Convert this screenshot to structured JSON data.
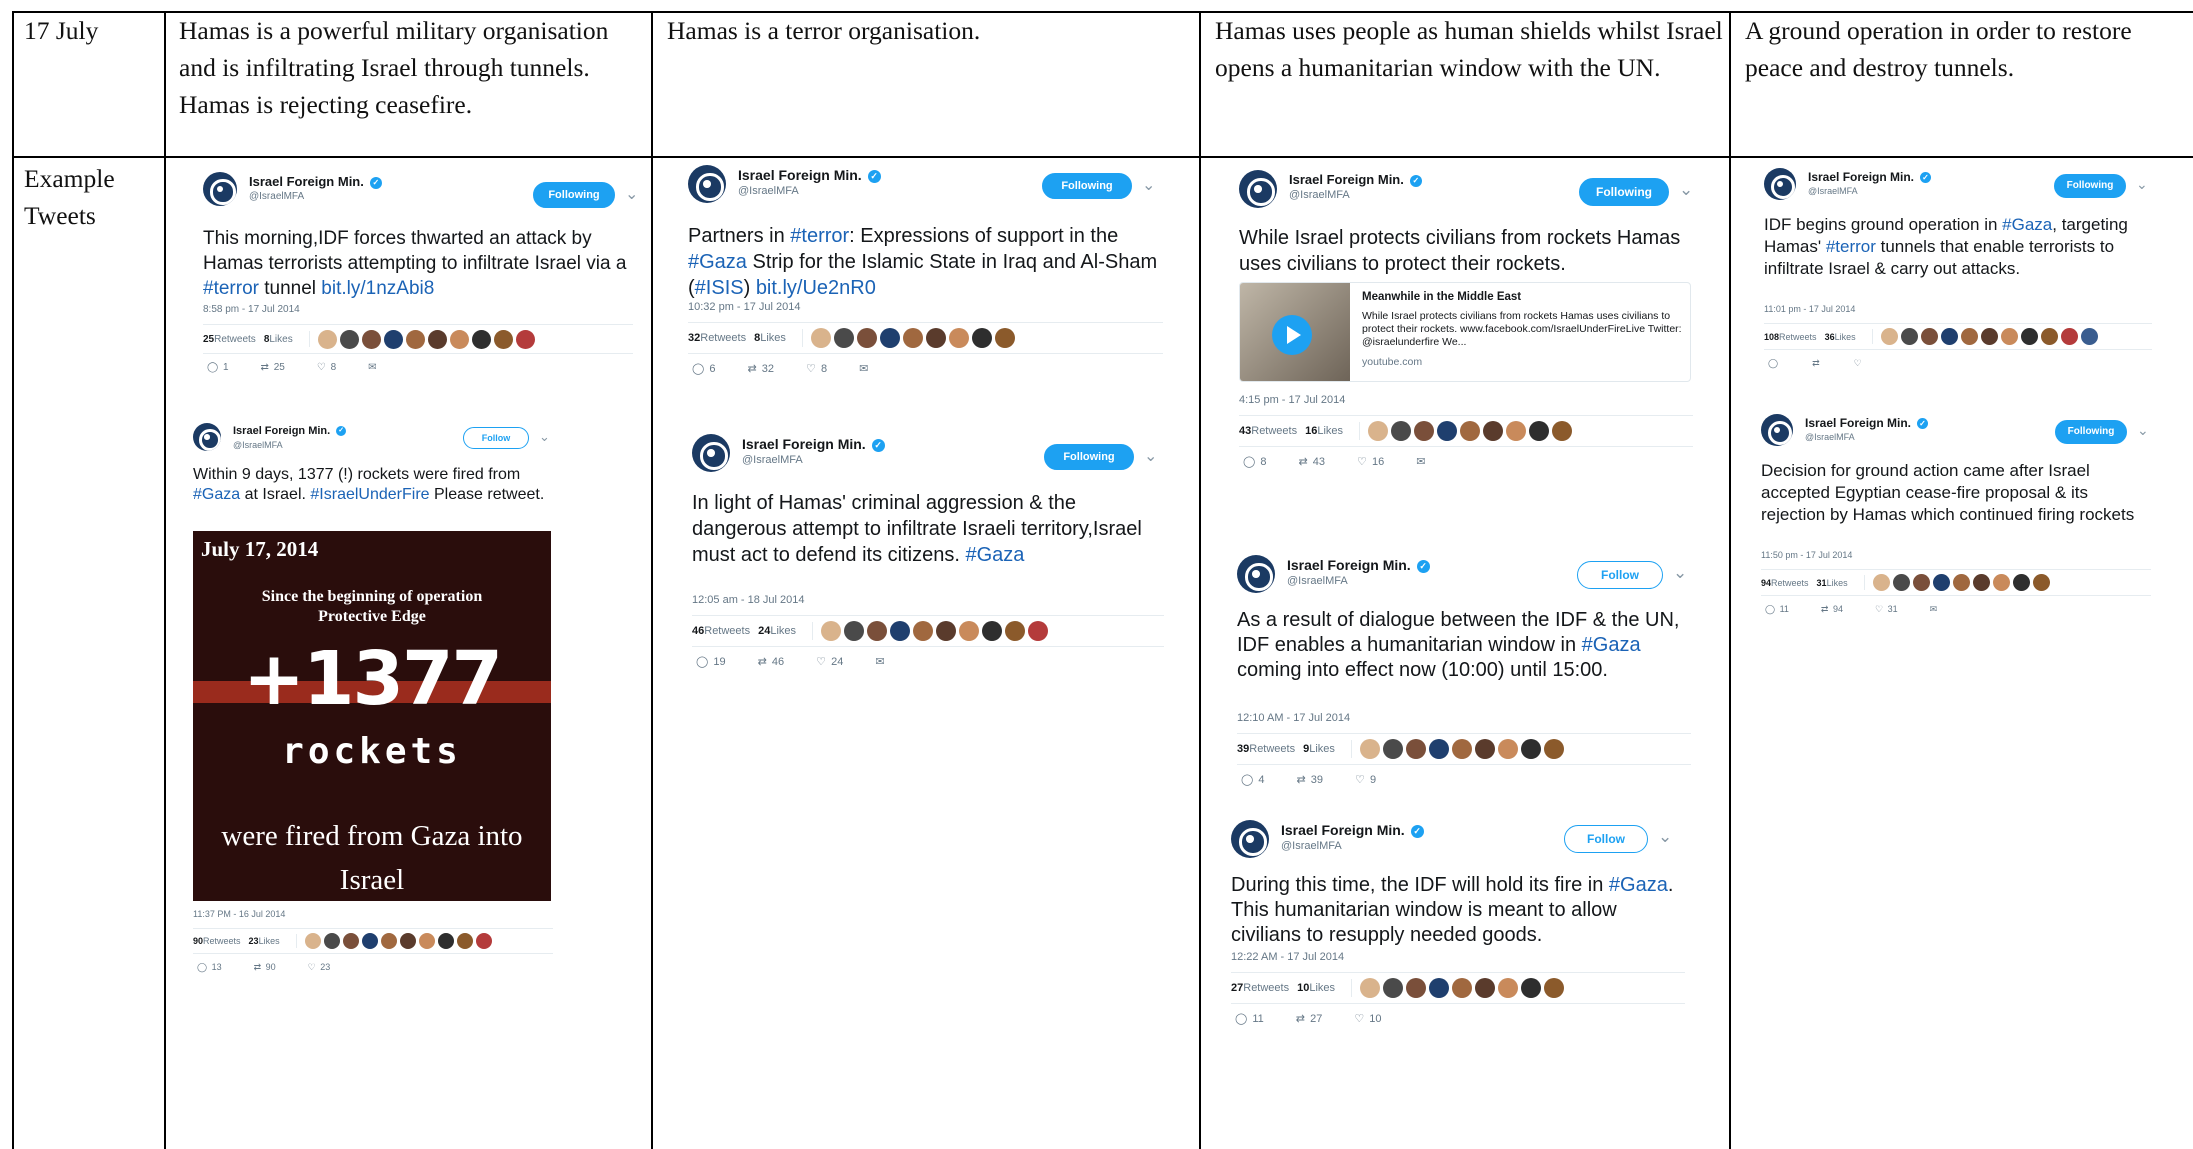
{
  "table": {
    "row1": {
      "date": "17 July",
      "c1": "Hamas is a powerful military organisation and is infiltrating Israel through tunnels. Hamas is rejecting ceasefire.",
      "c2": "Hamas is a terror organisation.",
      "c3": "Hamas uses people as human shields whilst Israel opens a humanitarian window with the UN.",
      "c4": "A ground operation in order to restore peace and destroy tunnels."
    },
    "row2": {
      "label": "Example Tweets"
    }
  },
  "tweets": {
    "t1": {
      "name": "Israel Foreign Min.",
      "handle": "@IsraelMFA",
      "button": "Following",
      "body": [
        "This morning,IDF forces thwarted an attack by Hamas terrorists attempting to infiltrate Israel via a ",
        "#terror",
        " tunnel ",
        "bit.ly/1nzAbi8"
      ],
      "time": "8:58 pm - 17 Jul 2014",
      "retweets": "25",
      "retweets_label": "Retweets",
      "likes": "8",
      "likes_label": "Likes",
      "replies": "1",
      "rt": "25",
      "lk": "8"
    },
    "t2": {
      "name": "Israel Foreign Min.",
      "handle": "@IsraelMFA",
      "button": "Follow",
      "body": [
        "Within 9 days, 1377 (!) rockets were fired from ",
        "#Gaza",
        " at Israel. ",
        "#IsraelUnderFire",
        " Please retweet."
      ],
      "image": {
        "date": "July 17, 2014",
        "since": "Since the beginning of operation Protective Edge",
        "number": "+1377",
        "rockets": "rockets",
        "fired": "were fired from Gaza into Israel"
      },
      "time": "11:37 PM - 16 Jul 2014",
      "retweets": "90",
      "retweets_label": "Retweets",
      "likes": "23",
      "likes_label": "Likes",
      "replies": "13",
      "rt": "90",
      "lk": "23"
    },
    "t3": {
      "name": "Israel Foreign Min.",
      "handle": "@IsraelMFA",
      "button": "Following",
      "body": [
        "Partners in ",
        "#terror",
        ": Expressions of support in the ",
        "#Gaza",
        " Strip for the Islamic State in Iraq and Al-Sham (",
        "#ISIS",
        ") ",
        "bit.ly/Ue2nR0"
      ],
      "time": "10:32 pm - 17 Jul 2014",
      "retweets": "32",
      "retweets_label": "Retweets",
      "likes": "8",
      "likes_label": "Likes",
      "replies": "6",
      "rt": "32",
      "lk": "8"
    },
    "t4": {
      "name": "Israel Foreign Min.",
      "handle": "@IsraelMFA",
      "button": "Following",
      "body": [
        "In light of Hamas' criminal aggression & the dangerous attempt to infiltrate Israeli territory,Israel must act to defend its citizens. ",
        "#Gaza"
      ],
      "time": "12:05 am - 18 Jul 2014",
      "retweets": "46",
      "retweets_label": "Retweets",
      "likes": "24",
      "likes_label": "Likes",
      "replies": "19",
      "rt": "46",
      "lk": "24"
    },
    "t5": {
      "name": "Israel Foreign Min.",
      "handle": "@IsraelMFA",
      "button": "Following",
      "body": [
        "While Israel protects civilians from rockets Hamas uses civilians to protect their rockets."
      ],
      "card": {
        "title": "Meanwhile in the Middle East",
        "desc": "While Israel protects civilians from rockets Hamas uses civilians to protect their rockets. www.facebook.com/IsraelUnderFireLive Twitter: @israelunderfire We...",
        "domain": "youtube.com"
      },
      "time": "4:15 pm - 17 Jul 2014",
      "retweets": "43",
      "retweets_label": "Retweets",
      "likes": "16",
      "likes_label": "Likes",
      "replies": "8",
      "rt": "43",
      "lk": "16"
    },
    "t6": {
      "name": "Israel Foreign Min.",
      "handle": "@IsraelMFA",
      "button": "Follow",
      "body": [
        "As a result of dialogue between the IDF & the UN, IDF enables a humanitarian window in ",
        "#Gaza",
        " coming into effect now (10:00) until 15:00."
      ],
      "time": "12:10 AM - 17 Jul 2014",
      "retweets": "39",
      "retweets_label": "Retweets",
      "likes": "9",
      "likes_label": "Likes",
      "replies": "4",
      "rt": "39",
      "lk": "9"
    },
    "t7": {
      "name": "Israel Foreign Min.",
      "handle": "@IsraelMFA",
      "button": "Follow",
      "body": [
        "During this time, the IDF will hold its fire in ",
        "#Gaza",
        ". This humanitarian window is meant to allow civilians to resupply needed goods."
      ],
      "time": "12:22 AM - 17 Jul 2014",
      "retweets": "27",
      "retweets_label": "Retweets",
      "likes": "10",
      "likes_label": "Likes",
      "replies": "11",
      "rt": "27",
      "lk": "10"
    },
    "t8": {
      "name": "Israel Foreign Min.",
      "handle": "@IsraelMFA",
      "button": "Following",
      "body": [
        "IDF begins ground operation in ",
        "#Gaza",
        ", targeting Hamas' ",
        "#terror",
        " tunnels that enable terrorists to infiltrate Israel & carry out attacks."
      ],
      "time": "11:01 pm - 17 Jul 2014",
      "retweets": "108",
      "retweets_label": "Retweets",
      "likes": "36",
      "likes_label": "Likes",
      "replies": "",
      "rt": "",
      "lk": ""
    },
    "t9": {
      "name": "Israel Foreign Min.",
      "handle": "@IsraelMFA",
      "button": "Following",
      "body": [
        "Decision for ground action came after Israel accepted Egyptian cease-fire proposal & its rejection by Hamas which continued firing rockets"
      ],
      "time": "11:50 pm - 17 Jul 2014",
      "retweets": "94",
      "retweets_label": "Retweets",
      "likes": "31",
      "likes_label": "Likes",
      "replies": "11",
      "rt": "94",
      "lk": "31"
    }
  },
  "icons": {
    "reply": "reply-icon",
    "retweet": "retweet-icon",
    "like": "like-icon",
    "dm": "message-icon",
    "verified": "verified-icon",
    "chevron": "chevron-down-icon"
  },
  "colors": {
    "link": "#1b63b6",
    "brand": "#1da1f2",
    "avatar": "#1b3a63"
  }
}
